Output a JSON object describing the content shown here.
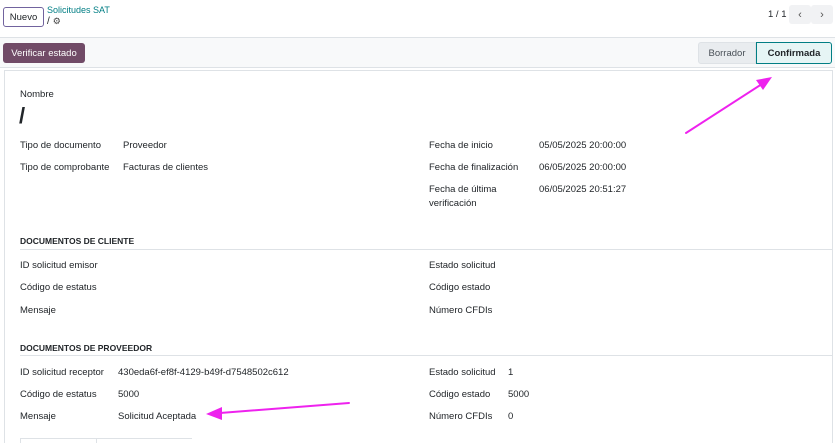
{
  "topbar": {
    "new_button": "Nuevo",
    "breadcrumb": "Solicitudes SAT",
    "record_name": "/",
    "pager": "1 / 1",
    "prev_icon": "chevron-left-icon",
    "next_icon": "chevron-right-icon",
    "gear_icon": "gear-icon"
  },
  "actionbar": {
    "verify_button": "Verificar estado",
    "stages": [
      {
        "label": "Borrador",
        "active": false
      },
      {
        "label": "Confirmada",
        "active": true
      }
    ]
  },
  "form": {
    "name_label": "Nombre",
    "name_value": "/",
    "left_fields": [
      {
        "label": "Tipo de documento",
        "value": "Proveedor"
      },
      {
        "label": "Tipo de comprobante",
        "value": "Facturas de clientes"
      }
    ],
    "right_fields": [
      {
        "label": "Fecha de inicio",
        "value": "05/05/2025 20:00:00"
      },
      {
        "label": "Fecha de finalización",
        "value": "06/05/2025 20:00:00"
      },
      {
        "label_line1": "Fecha de última",
        "label_line2": "verificación",
        "value": "06/05/2025 20:51:27"
      }
    ],
    "client_section": {
      "title": "DOCUMENTOS DE CLIENTE",
      "left": [
        {
          "label": "ID solicitud emisor",
          "value": ""
        },
        {
          "label": "Código de estatus",
          "value": ""
        },
        {
          "label": "Mensaje",
          "value": ""
        }
      ],
      "right": [
        {
          "label": "Estado solicitud",
          "value": ""
        },
        {
          "label": "Código estado",
          "value": ""
        },
        {
          "label": "Número CFDIs",
          "value": ""
        }
      ]
    },
    "provider_section": {
      "title": "DOCUMENTOS DE PROVEEDOR",
      "left": [
        {
          "label": "ID solicitud receptor",
          "value": "430eda6f-ef8f-4129-b49f-d7548502c612"
        },
        {
          "label": "Código de estatus",
          "value": "5000"
        },
        {
          "label": "Mensaje",
          "value": "Solicitud Aceptada"
        }
      ],
      "right": [
        {
          "label": "Estado solicitud",
          "value": "1"
        },
        {
          "label": "Código estado",
          "value": "5000"
        },
        {
          "label": "Número CFDIs",
          "value": "0"
        }
      ]
    }
  },
  "colors": {
    "primary": "#714b67",
    "accent": "#017e84",
    "annotation": "#ee22ee"
  }
}
